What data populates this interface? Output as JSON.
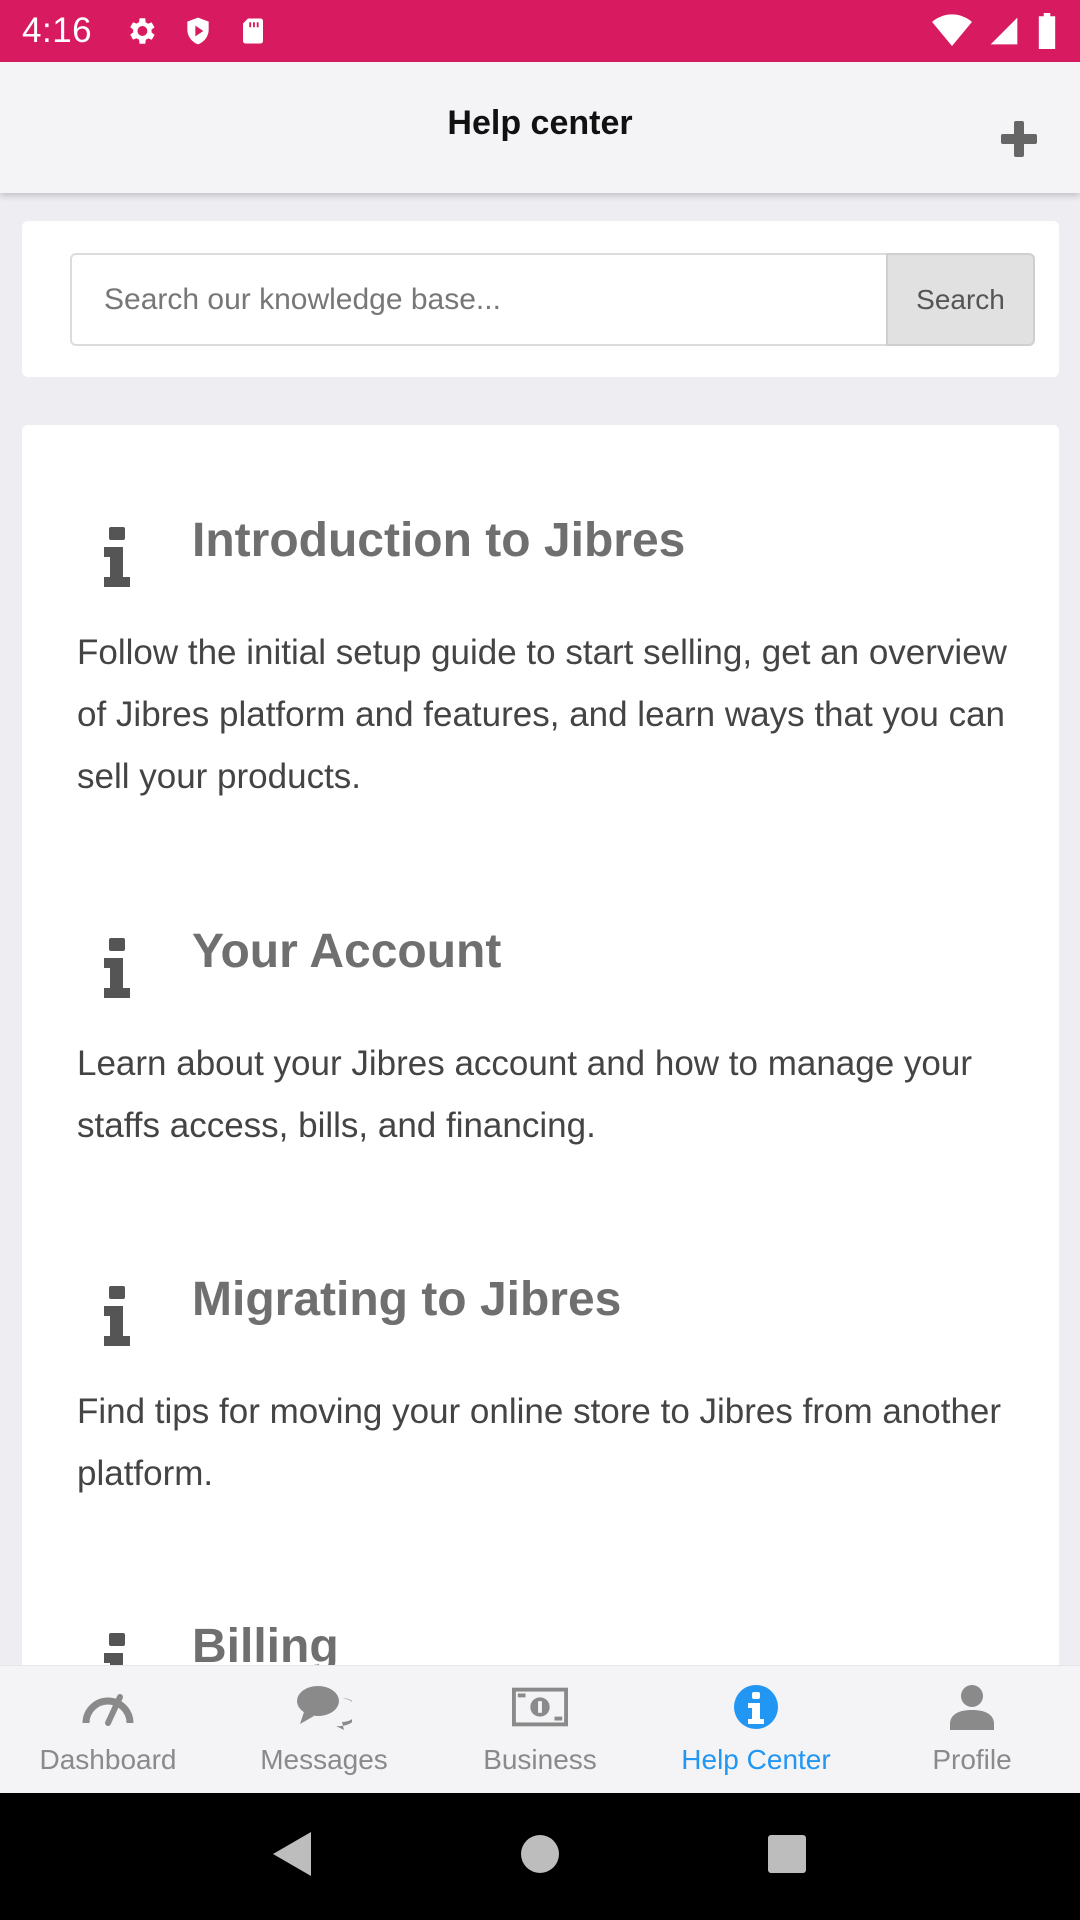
{
  "status_bar": {
    "time": "4:16",
    "icons_left": [
      "gear-icon",
      "shield-icon",
      "sd-card-icon"
    ],
    "icons_right": [
      "wifi-icon",
      "signal-icon",
      "battery-icon"
    ],
    "background": "#d81b60"
  },
  "app_bar": {
    "title": "Help center",
    "action_icon": "plus-icon"
  },
  "search": {
    "placeholder": "Search our knowledge base...",
    "value": "",
    "button_label": "Search"
  },
  "articles": [
    {
      "icon": "info-icon",
      "title": "Introduction to Jibres",
      "description": "Follow the initial setup guide to start selling, get an overview of Jibres platform and features, and learn ways that you can sell your products."
    },
    {
      "icon": "info-icon",
      "title": "Your Account",
      "description": "Learn about your Jibres account and how to manage your staffs access, bills, and financing."
    },
    {
      "icon": "info-icon",
      "title": "Migrating to Jibres",
      "description": "Find tips for moving your online store to Jibres from another platform."
    },
    {
      "icon": "info-icon",
      "title": "Billing",
      "description": ""
    }
  ],
  "bottom_nav": {
    "active_index": 3,
    "active_color": "#2196f3",
    "items": [
      {
        "label": "Dashboard",
        "icon": "gauge-icon"
      },
      {
        "label": "Messages",
        "icon": "chat-bubbles-icon"
      },
      {
        "label": "Business",
        "icon": "banknote-icon"
      },
      {
        "label": "Help Center",
        "icon": "info-circle-icon"
      },
      {
        "label": "Profile",
        "icon": "user-icon"
      }
    ]
  },
  "system_nav": {
    "buttons": [
      "back-icon",
      "home-icon",
      "recents-icon"
    ]
  }
}
